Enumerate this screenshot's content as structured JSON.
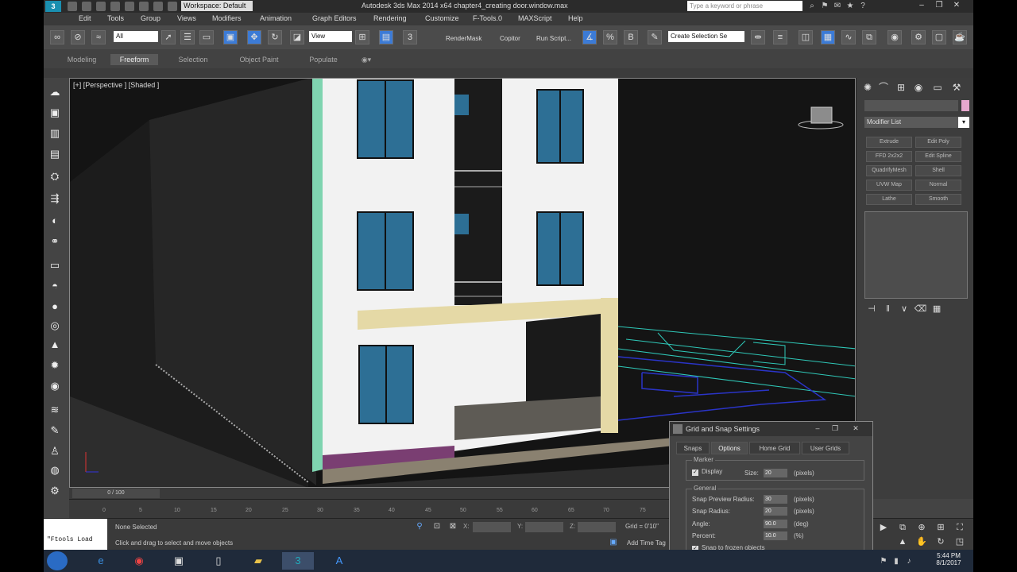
{
  "titlebar": {
    "workspace": "Workspace: Default",
    "window_title": "Autodesk 3ds Max 2014 x64    chapter4_creating door.window.max",
    "search_placeholder": "Type a keyword or phrase"
  },
  "menu": [
    "Edit",
    "Tools",
    "Group",
    "Views",
    "Modifiers",
    "Animation",
    "Graph Editors",
    "Rendering",
    "Customize",
    "F-Tools.0",
    "MAXScript",
    "Help"
  ],
  "toolbar": {
    "selection_filter": "All",
    "reference_coord": "View",
    "rendermask_label": "RenderMask",
    "copitor_label": "Copitor",
    "run_script_label": "Run Script...",
    "named_selection": "Create Selection Se"
  },
  "ribbon_tabs": [
    "Modeling",
    "Freeform",
    "Selection",
    "Object Paint",
    "Populate"
  ],
  "viewport": {
    "label": "[+] [Perspective ] [Shaded ]"
  },
  "command_panel": {
    "modifier_list": "Modifier List",
    "modifier_buttons": [
      "Extrude",
      "Edit Poly",
      "FFD 2x2x2",
      "Edit Spline",
      "QuadrifyMesh",
      "Shell",
      "UVW Map",
      "Normal",
      "Lathe",
      "Smooth"
    ],
    "swatch_color": "#e7a7ce"
  },
  "grid_snap_dialog": {
    "title": "Grid and Snap Settings",
    "tabs": [
      "Snaps",
      "Options",
      "Home Grid",
      "User Grids"
    ],
    "active_tab": "Options",
    "marker_group": "Marker",
    "display_label": "Display",
    "size_label": "Size:",
    "size_value": "20",
    "size_unit": "(pixels)",
    "general_group": "General",
    "snap_preview_label": "Snap Preview Radius:",
    "snap_preview_value": "30",
    "snap_preview_unit": "(pixels)",
    "snap_radius_label": "Snap Radius:",
    "snap_radius_value": "20",
    "snap_radius_unit": "(pixels)",
    "angle_label": "Angle:",
    "angle_value": "90.0",
    "angle_unit": "(deg)",
    "percent_label": "Percent:",
    "percent_value": "10.0",
    "percent_unit": "(%)",
    "snap_frozen_label": "Snap to frozen objects"
  },
  "timeline": {
    "slider": "0 / 100",
    "ticks": [
      "0",
      "5",
      "10",
      "15",
      "20",
      "25",
      "30",
      "35",
      "40",
      "45",
      "50",
      "55",
      "60",
      "65",
      "70",
      "75"
    ]
  },
  "status": {
    "maxscript_listener": "\"Ftools Load",
    "selection": "None Selected",
    "prompt": "Click and drag to select and move objects",
    "x_label": "X:",
    "y_label": "Y:",
    "z_label": "Z:",
    "grid": "Grid = 0'10\"",
    "add_time_tag": "Add Time Tag"
  },
  "taskbar": {
    "time": "5:44 PM",
    "date": "8/1/2017"
  }
}
